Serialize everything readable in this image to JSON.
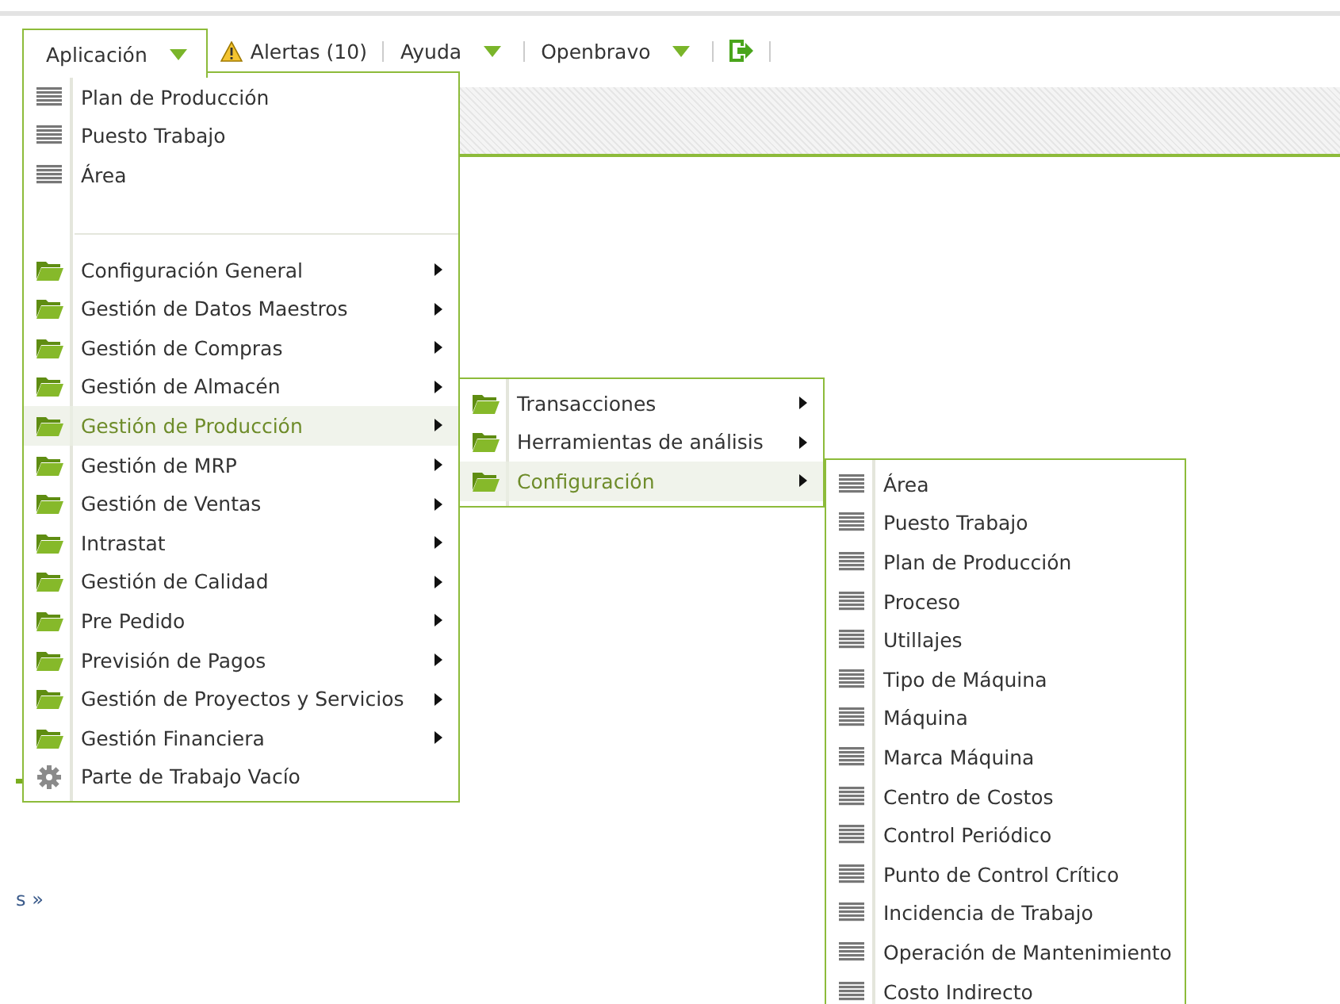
{
  "toolbar": [
    {
      "kind": "menu",
      "label": "Aplicación",
      "open": true
    },
    {
      "kind": "alert",
      "label": "Alertas (10)"
    },
    {
      "kind": "menu",
      "label": "Ayuda",
      "open": false
    },
    {
      "kind": "menu",
      "label": "Openbravo",
      "open": false
    },
    {
      "kind": "logout"
    }
  ],
  "background": {
    "fragment": "s »"
  },
  "main_menu": {
    "items": [
      {
        "kind": "window",
        "label": "Plan de Producción",
        "selected": false
      },
      {
        "kind": "window",
        "label": "Puesto Trabajo",
        "selected": false
      },
      {
        "kind": "window",
        "label": "Área",
        "selected": false
      },
      {
        "kind": "separator"
      },
      {
        "kind": "folder",
        "label": "Configuración General",
        "selected": false
      },
      {
        "kind": "folder",
        "label": "Gestión de Datos Maestros",
        "selected": false
      },
      {
        "kind": "folder",
        "label": "Gestión de Compras",
        "selected": false
      },
      {
        "kind": "folder",
        "label": "Gestión de Almacén",
        "selected": false
      },
      {
        "kind": "folder",
        "label": "Gestión de Producción",
        "selected": true
      },
      {
        "kind": "folder",
        "label": "Gestión de MRP",
        "selected": false
      },
      {
        "kind": "folder",
        "label": "Gestión de Ventas",
        "selected": false
      },
      {
        "kind": "folder",
        "label": "Intrastat",
        "selected": false
      },
      {
        "kind": "folder",
        "label": "Gestión de Calidad",
        "selected": false
      },
      {
        "kind": "folder",
        "label": "Pre Pedido",
        "selected": false
      },
      {
        "kind": "folder",
        "label": "Previsión de Pagos",
        "selected": false
      },
      {
        "kind": "folder",
        "label": "Gestión de Proyectos y Servicios",
        "selected": false
      },
      {
        "kind": "folder",
        "label": "Gestión Financiera",
        "selected": false
      },
      {
        "kind": "process",
        "label": "Parte de Trabajo Vacío",
        "selected": false
      }
    ]
  },
  "production_menu": {
    "items": [
      {
        "kind": "folder",
        "label": "Transacciones",
        "selected": false
      },
      {
        "kind": "folder",
        "label": "Herramientas de análisis",
        "selected": false
      },
      {
        "kind": "folder",
        "label": "Configuración",
        "selected": true
      }
    ]
  },
  "configuration_menu": {
    "items": [
      {
        "kind": "window",
        "label": "Área",
        "selected": false
      },
      {
        "kind": "window",
        "label": "Puesto Trabajo",
        "selected": false
      },
      {
        "kind": "window",
        "label": "Plan de Producción",
        "selected": false
      },
      {
        "kind": "window",
        "label": "Proceso",
        "selected": false
      },
      {
        "kind": "window",
        "label": "Utillajes",
        "selected": false
      },
      {
        "kind": "window",
        "label": "Tipo de Máquina",
        "selected": false
      },
      {
        "kind": "window",
        "label": "Máquina",
        "selected": false
      },
      {
        "kind": "window",
        "label": "Marca Máquina",
        "selected": false
      },
      {
        "kind": "window",
        "label": "Centro de Costos",
        "selected": false
      },
      {
        "kind": "window",
        "label": "Control Periódico",
        "selected": false
      },
      {
        "kind": "window",
        "label": "Punto de Control Crítico",
        "selected": false
      },
      {
        "kind": "window",
        "label": "Incidencia de Trabajo",
        "selected": false
      },
      {
        "kind": "window",
        "label": "Operación de Mantenimiento",
        "selected": false
      },
      {
        "kind": "window",
        "label": "Costo Indirecto",
        "selected": false
      }
    ]
  }
}
